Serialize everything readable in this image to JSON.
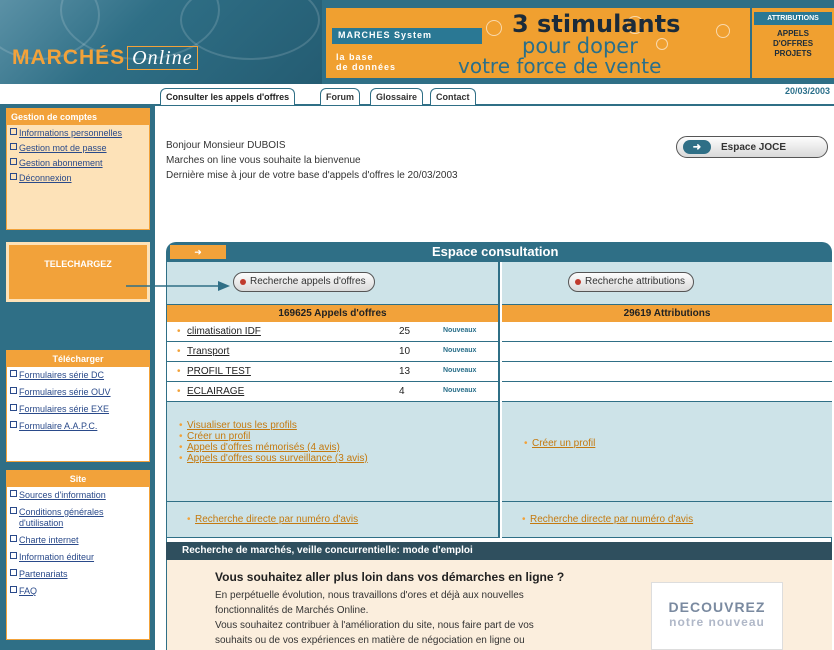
{
  "header": {
    "logo_main": "MARCHÉS",
    "logo_sub": "Online",
    "banner_system": "MARCHES System",
    "banner_base_1": "la base",
    "banner_base_2": "de données",
    "banner_line1": "3 stimulants",
    "banner_line2": "pour doper",
    "banner_line3": "votre force de vente",
    "ad_line1": "ATTRIBUTIONS",
    "ad_line2": "APPELS",
    "ad_line3": "D'OFFRES",
    "ad_line4": "PROJETS",
    "date": "20/03/2003"
  },
  "tabs": [
    {
      "label": "Consulter les appels d'offres"
    },
    {
      "label": "Forum"
    },
    {
      "label": "Glossaire"
    },
    {
      "label": "Contact"
    }
  ],
  "sidebar": {
    "account_title": "Gestion de comptes",
    "account_items": [
      {
        "label": "Informations personnelles"
      },
      {
        "label": "Gestion mot de passe"
      },
      {
        "label": "Gestion abonnement"
      },
      {
        "label": "Déconnexion"
      }
    ],
    "download_banner": "TELECHARGEZ",
    "forms_title": "Télécharger",
    "forms_items": [
      {
        "label": "Formulaires série DC"
      },
      {
        "label": "Formulaires série OUV"
      },
      {
        "label": "Formulaires série EXE"
      },
      {
        "label": "Formulaire A.A.P.C."
      }
    ],
    "site_title": "Site",
    "site_items": [
      {
        "label": "Sources d'information"
      },
      {
        "label": "Conditions générales d'utilisation"
      },
      {
        "label": "Charte internet"
      },
      {
        "label": "Information éditeur"
      },
      {
        "label": "Partenariats"
      },
      {
        "label": "FAQ"
      }
    ]
  },
  "welcome": {
    "line1": "Bonjour Monsieur DUBOIS",
    "line2": "Marches on line vous souhaite la bienvenue",
    "line3": "Dernière mise à jour de votre base d'appels d'offres le 20/03/2003"
  },
  "joce_button": "Espace JOCE",
  "espace": {
    "title": "Espace consultation",
    "search_offers": "Recherche appels d'offres",
    "search_attrib": "Recherche attributions",
    "offers_header": "169625 Appels d'offres",
    "attrib_header": "29619 Attributions",
    "profiles": [
      {
        "name": "climatisation IDF",
        "count": "25",
        "badge": "Nouveaux"
      },
      {
        "name": "Transport",
        "count": "10",
        "badge": "Nouveaux"
      },
      {
        "name": "PROFIL TEST",
        "count": "13",
        "badge": "Nouveaux"
      },
      {
        "name": "ECLAIRAGE",
        "count": "4",
        "badge": "Nouveaux"
      }
    ],
    "left_links": [
      {
        "label": "Visualiser tous les profils"
      },
      {
        "label": "Créer un profil"
      },
      {
        "label": "Appels d'offres mémorisés (4 avis)"
      },
      {
        "label": "Appels d'offres sous surveillance (3 avis)"
      }
    ],
    "right_link": "Créer un profil",
    "direct_left": "Recherche directe par numéro d'avis",
    "direct_right": "Recherche directe par numéro d'avis"
  },
  "mode_bar": "Recherche de marchés, veille concurrentielle: mode d'emploi",
  "promo": {
    "question": "Vous souhaitez aller plus loin dans vos démarches en ligne ?",
    "p1": "En perpétuelle évolution, nous travaillons d'ores et déjà aux nouvelles",
    "p2": "fonctionnalités de Marchés Online.",
    "p3": "Vous souhaitez contribuer à l'amélioration du site, nous faire part de vos",
    "p4": "souhaits ou de vos expériences en matière de négociation en ligne ou",
    "badge1": "DECOUVREZ",
    "badge2": "notre nouveau"
  },
  "colors": {
    "teal": "#2f6f86",
    "orange": "#f2a23a",
    "light_teal": "#cde3e8"
  }
}
